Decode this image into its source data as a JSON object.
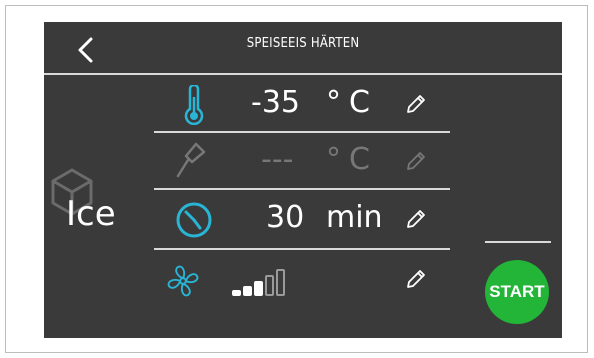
{
  "header": {
    "title": "SPEISEEIS HÄRTEN"
  },
  "mode": {
    "label": "Ice"
  },
  "rows": {
    "temperature": {
      "value": "-35",
      "unit": "°C"
    },
    "probe": {
      "value": "---",
      "unit": "°C"
    },
    "time": {
      "value": "30",
      "unit": "min"
    },
    "fan": {
      "level": 3,
      "max": 5
    }
  },
  "actions": {
    "start_label": "START"
  },
  "colors": {
    "accent": "#29b6d6",
    "start": "#22b537",
    "screen": "#3a3a3a"
  },
  "icons": [
    "back-arrow-icon",
    "thermometer-icon",
    "core-probe-icon",
    "clock-icon",
    "fan-icon",
    "pencil-icon",
    "cube-icon",
    "fan-speed-bars-icon"
  ]
}
